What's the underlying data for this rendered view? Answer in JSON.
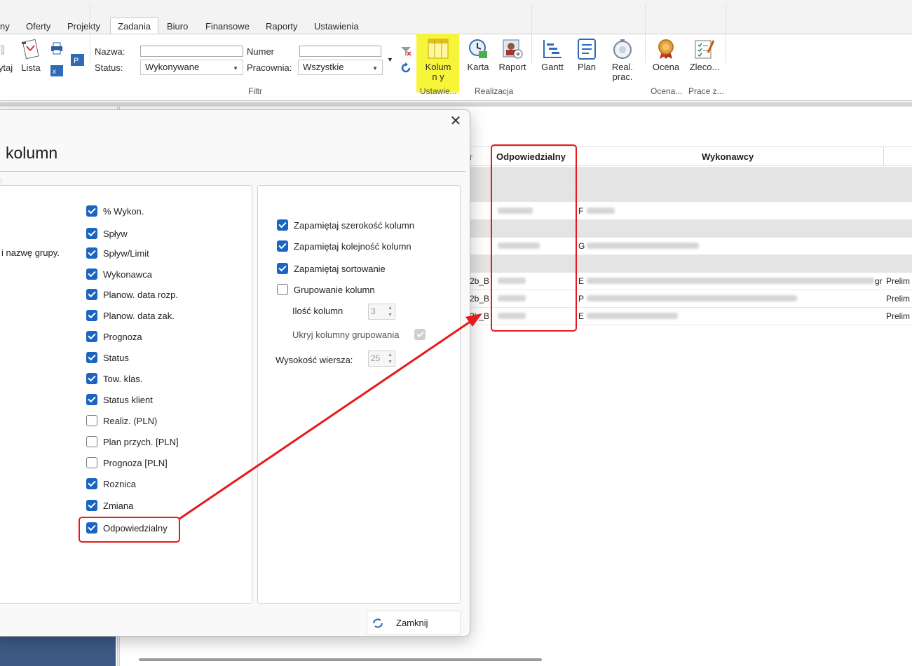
{
  "menu": {
    "tabs": [
      "ny",
      "Oferty",
      "Projekty",
      "Zadania",
      "Biuro",
      "Finansowe",
      "Raporty",
      "Ustawienia"
    ],
    "active_tab": "Zadania"
  },
  "ribbon": {
    "btn_partial": "ytaj",
    "btn_lista": "Lista",
    "filter": {
      "nazwa_label": "Nazwa:",
      "status_label": "Status:",
      "status_value": "Wykonywane",
      "numer_label": "Numer",
      "pracownia_label": "Pracownia:",
      "pracownia_value": "Wszystkie",
      "group": "Filtr"
    },
    "kolumny": "Kolumn y",
    "ustawienia_group": "Ustawie...",
    "karta": "Karta",
    "raport": "Raport",
    "realizacja_group": "Realizacja",
    "gantt": "Gantt",
    "plan": "Plan",
    "real_prac": "Real. prac.",
    "ocena": "Ocena",
    "ocena_group": "Ocena...",
    "zleco": "Zleco...",
    "prace_group": "Prace z..."
  },
  "grid": {
    "header_partial": "r",
    "col_odpowiedzialny": "Odpowiedzialny",
    "col_wykonawcy": "Wykonawcy",
    "row_prefix": "2b_B",
    "row_e": "E",
    "row_p": "P",
    "row_g": "G",
    "row_f": "F",
    "row_gr": "gr",
    "prelim": "Prelim"
  },
  "dialog": {
    "title": "kolumn",
    "left_text": "i nazwę grupy.",
    "columns": [
      {
        "label": "% Wykon.",
        "checked": true
      },
      {
        "label": "Spływ",
        "checked": true
      },
      {
        "label": "Spływ/Limit",
        "checked": true
      },
      {
        "label": "Wykonawca",
        "checked": true
      },
      {
        "label": "Planow. data rozp.",
        "checked": true
      },
      {
        "label": "Planow. data zak.",
        "checked": true
      },
      {
        "label": "Prognoza",
        "checked": true
      },
      {
        "label": "Status",
        "checked": true
      },
      {
        "label": "Tow. klas.",
        "checked": true
      },
      {
        "label": "Status klient",
        "checked": true
      },
      {
        "label": "Realiz. (PLN)",
        "checked": false
      },
      {
        "label": "Plan przych. [PLN]",
        "checked": false
      },
      {
        "label": "Prognoza [PLN]",
        "checked": false
      },
      {
        "label": "Roznica",
        "checked": true
      },
      {
        "label": "Zmiana",
        "checked": true
      },
      {
        "label": "Odpowiedzialny",
        "checked": true
      }
    ],
    "options": {
      "remember_width": "Zapamiętaj szerokość kolumn",
      "remember_order": "Zapamiętaj kolejność kolumn",
      "remember_sort": "Zapamiętaj sortowanie",
      "grouping": "Grupowanie kolumn",
      "columns_count_label": "Ilość kolumn",
      "columns_count_value": "3",
      "hide_grouping": "Ukryj kolumny grupowania",
      "row_height_label": "Wysokość wiersza:",
      "row_height_value": "25"
    },
    "close_label": "Zamknij"
  }
}
